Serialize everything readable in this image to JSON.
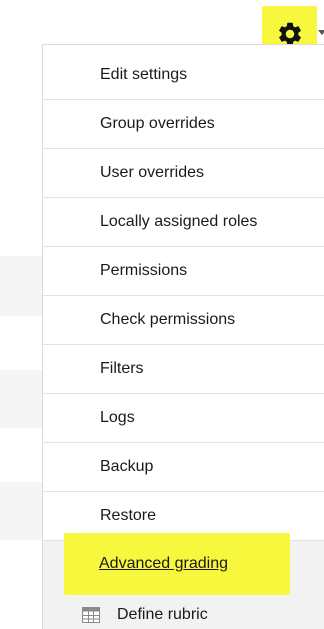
{
  "menu": {
    "items": [
      {
        "label": "Edit settings"
      },
      {
        "label": "Group overrides"
      },
      {
        "label": "User overrides"
      },
      {
        "label": "Locally assigned roles"
      },
      {
        "label": "Permissions"
      },
      {
        "label": "Check permissions"
      },
      {
        "label": "Filters"
      },
      {
        "label": "Logs"
      },
      {
        "label": "Backup"
      },
      {
        "label": "Restore"
      }
    ],
    "advanced_grading": "Advanced grading",
    "sub_items": [
      {
        "label": "Define rubric",
        "icon": "table-icon"
      }
    ]
  },
  "icons": {
    "settings": "gear-icon",
    "dropdown": "caret-down-icon"
  },
  "colors": {
    "highlight": "#f7f73d",
    "text": "#1a1a1a",
    "divider": "#e3e3e3"
  }
}
